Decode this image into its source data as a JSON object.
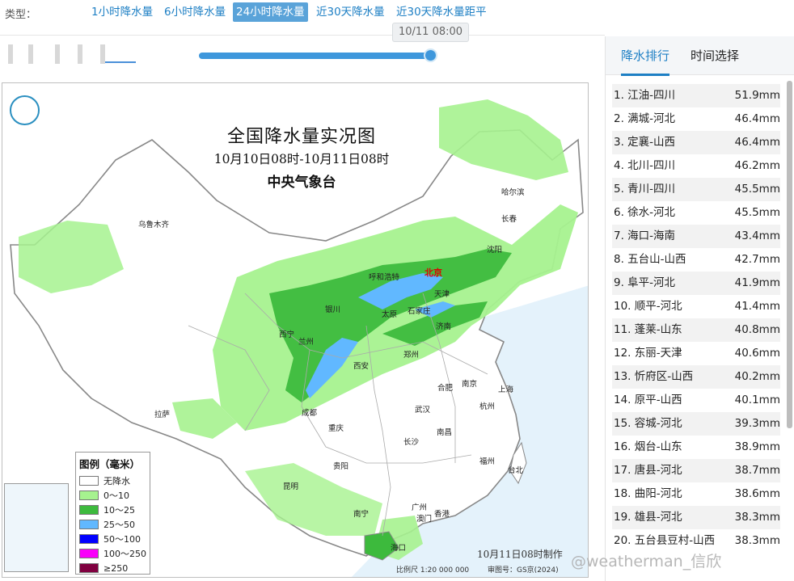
{
  "toolbar": {
    "type_label": "类型：",
    "tabs": [
      {
        "label": "1小时降水量",
        "active": false
      },
      {
        "label": "6小时降水量",
        "active": false
      },
      {
        "label": "24小时降水量",
        "active": true
      },
      {
        "label": "近30天降水量",
        "active": false
      },
      {
        "label": "近30天降水量距平",
        "active": false
      }
    ]
  },
  "timeline": {
    "current_time": "10/11 08:00"
  },
  "map": {
    "title": "全国降水量实况图",
    "subtitle": "10月10日08时-10月11日08时",
    "agency": "中央气象台",
    "footer_made": "10月11日08时制作",
    "scale": "比例尺 1:20 000 000",
    "approval": "审图号：GS京(2024)",
    "legend": {
      "title": "图例（毫米）",
      "items": [
        {
          "label": "无降水",
          "color": "#ffffff"
        },
        {
          "label": "0～10",
          "color": "#a6f28f"
        },
        {
          "label": "10～25",
          "color": "#3dba3d"
        },
        {
          "label": "25～50",
          "color": "#61b8ff"
        },
        {
          "label": "50～100",
          "color": "#0000ff"
        },
        {
          "label": "100～250",
          "color": "#fa00fa"
        },
        {
          "label": "≥250",
          "color": "#800040"
        }
      ]
    },
    "cities": [
      {
        "name": "哈尔滨",
        "red": false
      },
      {
        "name": "长春",
        "red": false
      },
      {
        "name": "乌鲁木齐",
        "red": false
      },
      {
        "name": "沈阳",
        "red": false
      },
      {
        "name": "呼和浩特",
        "red": false
      },
      {
        "name": "北京",
        "red": true
      },
      {
        "name": "天津",
        "red": false
      },
      {
        "name": "银川",
        "red": false
      },
      {
        "name": "太原",
        "red": false
      },
      {
        "name": "石家庄",
        "red": false
      },
      {
        "name": "西宁",
        "red": false
      },
      {
        "name": "兰州",
        "red": false
      },
      {
        "name": "济南",
        "red": false
      },
      {
        "name": "郑州",
        "red": false
      },
      {
        "name": "西安",
        "red": false
      },
      {
        "name": "合肥",
        "red": false
      },
      {
        "name": "南京",
        "red": false
      },
      {
        "name": "上海",
        "red": false
      },
      {
        "name": "拉萨",
        "red": false
      },
      {
        "name": "成都",
        "red": false
      },
      {
        "name": "武汉",
        "red": false
      },
      {
        "name": "杭州",
        "red": false
      },
      {
        "name": "重庆",
        "red": false
      },
      {
        "name": "南昌",
        "red": false
      },
      {
        "name": "长沙",
        "red": false
      },
      {
        "name": "福州",
        "red": false
      },
      {
        "name": "贵阳",
        "red": false
      },
      {
        "name": "台北",
        "red": false
      },
      {
        "name": "昆明",
        "red": false
      },
      {
        "name": "广州",
        "red": false
      },
      {
        "name": "南宁",
        "red": false
      },
      {
        "name": "澳门",
        "red": false
      },
      {
        "name": "香港",
        "red": false
      },
      {
        "name": "海口",
        "red": false
      }
    ]
  },
  "sidepanel": {
    "tabs": [
      {
        "label": "降水排行",
        "active": true
      },
      {
        "label": "时间选择",
        "active": false
      }
    ],
    "ranking": [
      {
        "name": "1. 江油-四川",
        "value": "51.9mm"
      },
      {
        "name": "2. 满城-河北",
        "value": "46.4mm"
      },
      {
        "name": "3. 定襄-山西",
        "value": "46.4mm"
      },
      {
        "name": "4. 北川-四川",
        "value": "46.2mm"
      },
      {
        "name": "5. 青川-四川",
        "value": "45.5mm"
      },
      {
        "name": "6. 徐水-河北",
        "value": "45.5mm"
      },
      {
        "name": "7. 海口-海南",
        "value": "43.4mm"
      },
      {
        "name": "8. 五台山-山西",
        "value": "42.7mm"
      },
      {
        "name": "9. 阜平-河北",
        "value": "41.9mm"
      },
      {
        "name": "10. 顺平-河北",
        "value": "41.4mm"
      },
      {
        "name": "11. 蓬莱-山东",
        "value": "40.8mm"
      },
      {
        "name": "12. 东丽-天津",
        "value": "40.6mm"
      },
      {
        "name": "13. 忻府区-山西",
        "value": "40.2mm"
      },
      {
        "name": "14. 原平-山西",
        "value": "40.1mm"
      },
      {
        "name": "15. 容城-河北",
        "value": "39.3mm"
      },
      {
        "name": "16. 烟台-山东",
        "value": "38.9mm"
      },
      {
        "name": "17. 唐县-河北",
        "value": "38.7mm"
      },
      {
        "name": "18. 曲阳-河北",
        "value": "38.6mm"
      },
      {
        "name": "19. 雄县-河北",
        "value": "38.3mm"
      },
      {
        "name": "20. 五台县豆村-山西",
        "value": "38.3mm"
      }
    ]
  },
  "watermark": "@weatherman_信欣"
}
